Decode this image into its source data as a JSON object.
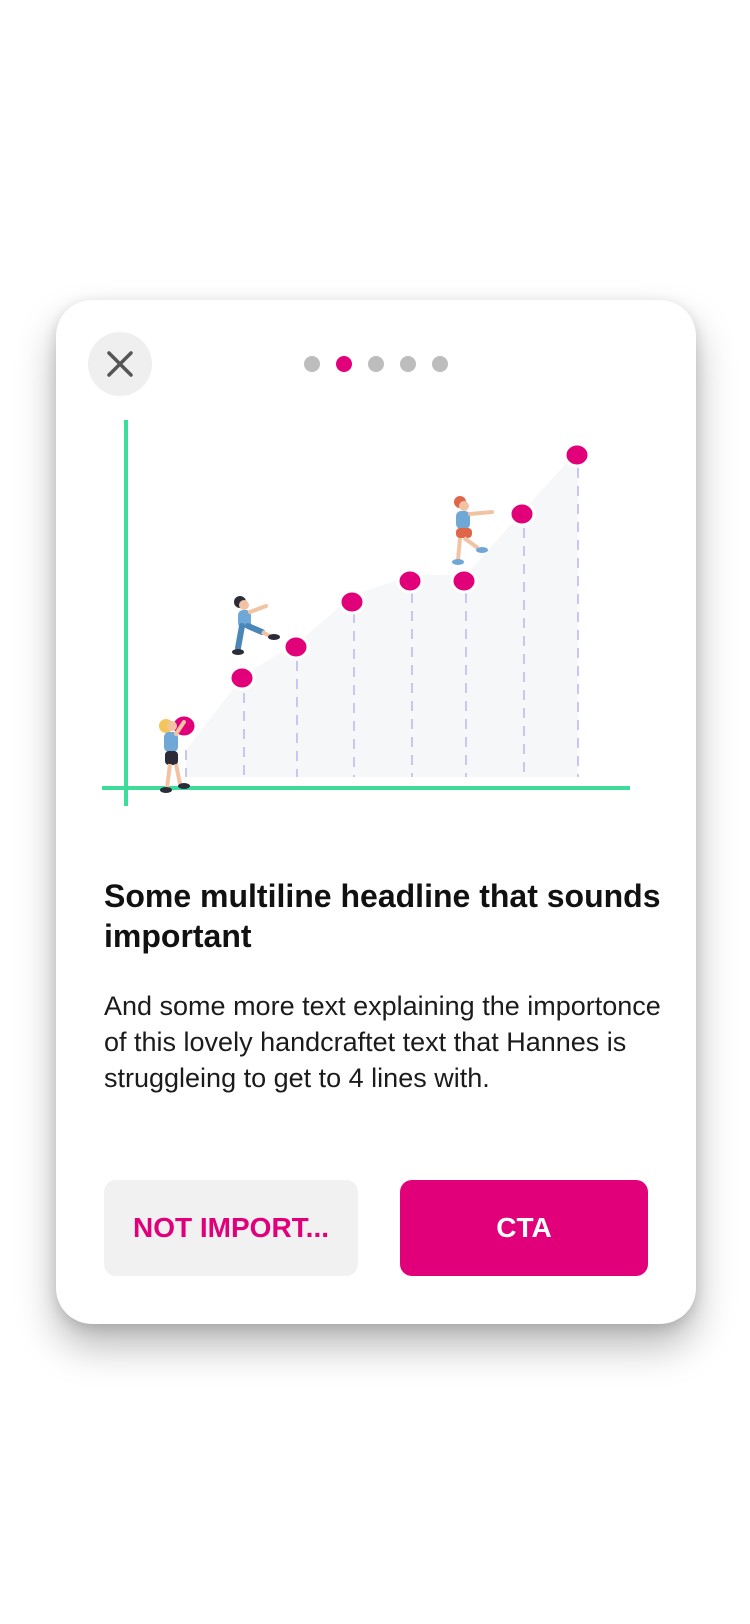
{
  "dialog": {
    "close_icon": "close-icon",
    "pagination": {
      "total": 5,
      "active_index": 1
    },
    "illustration": {
      "accent_color": "#e2007a",
      "axis_color": "#3ddc9a",
      "dash_color": "#c9c6f2"
    },
    "headline": "Some multiline headline that sounds important",
    "body": "And some more text explaining the importonce of this lovely handcraftet text that Hannes is struggleing to get to 4 lines with.",
    "secondary_button_label": "NOT IMPORT...",
    "primary_button_label": "CTA",
    "colors": {
      "accent": "#e2007a",
      "secondary_bg": "#f1f1f1",
      "inactive_dot": "#bdbdbd"
    }
  }
}
